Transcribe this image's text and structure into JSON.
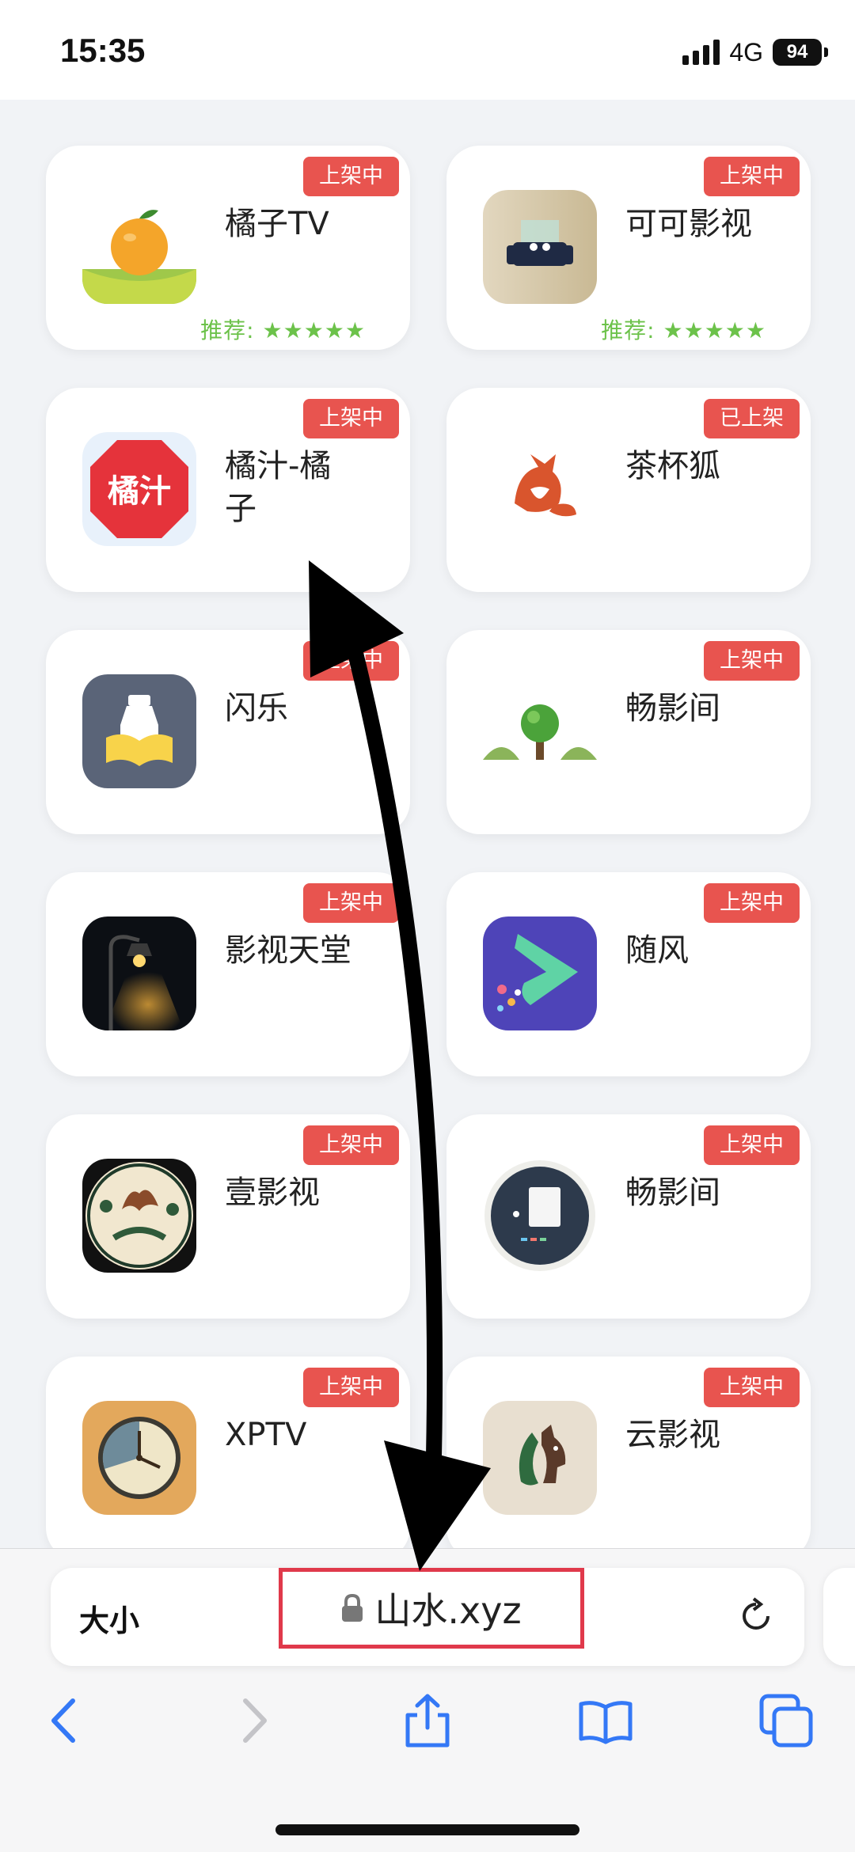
{
  "status": {
    "time": "15:35",
    "network": "4G",
    "battery": "94"
  },
  "apps": [
    {
      "name": "橘子TV",
      "badge": "上架中",
      "rec": "推荐: ★★★★★",
      "icon": "orange-icon"
    },
    {
      "name": "可可影视",
      "badge": "上架中",
      "rec": "推荐: ★★★★★",
      "icon": "sofa-icon"
    },
    {
      "name": "橘汁-橘子",
      "badge": "上架中",
      "icon": "juzhi-icon",
      "icon_text": "橘汁"
    },
    {
      "name": "茶杯狐",
      "badge": "已上架",
      "icon": "fox-icon"
    },
    {
      "name": "闪乐",
      "badge": "上架中",
      "icon": "book-icon"
    },
    {
      "name": "畅影间",
      "badge": "上架中",
      "icon": "tree-icon"
    },
    {
      "name": "影视天堂",
      "badge": "上架中",
      "icon": "lamp-icon"
    },
    {
      "name": "随风",
      "badge": "上架中",
      "icon": "play-icon"
    },
    {
      "name": "壹影视",
      "badge": "上架中",
      "icon": "emblem-icon"
    },
    {
      "name": "畅影间",
      "badge": "上架中",
      "icon": "tablet-icon"
    },
    {
      "name": "XPTV",
      "badge": "上架中",
      "icon": "clock-icon"
    },
    {
      "name": "云影视",
      "badge": "上架中",
      "icon": "horse-icon"
    }
  ],
  "browser": {
    "text_size": "大小",
    "url": "山水.xyz"
  },
  "colors": {
    "badge": "#e8544f",
    "rec": "#6cc24a",
    "url_highlight": "#e0394b",
    "toolbar_blue": "#3478f6"
  }
}
